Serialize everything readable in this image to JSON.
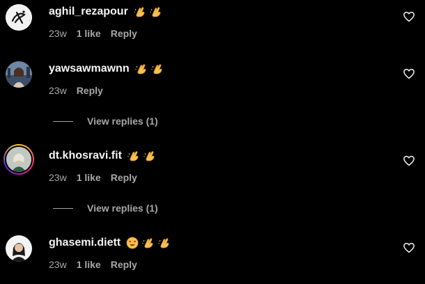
{
  "colors": {
    "background": "#000000",
    "username": "#f5f5f5",
    "meta": "#a8a8a8"
  },
  "comments": [
    {
      "username": "aghil_rezapour",
      "emojis": [
        "clapping-hands-emoji",
        "clapping-hands-emoji"
      ],
      "time": "23w",
      "likes": "1 like",
      "reply": "Reply",
      "avatar": "calligraphy-logo-avatar"
    },
    {
      "username": "yawsawmawnn",
      "emojis": [
        "clapping-hands-emoji",
        "clapping-hands-emoji"
      ],
      "time": "23w",
      "likes": "",
      "reply": "Reply",
      "view_replies": "View replies (1)",
      "avatar": "city-photo-avatar"
    },
    {
      "username": "dt.khosravi.fit",
      "emojis": [
        "clapping-hands-emoji",
        "clapping-hands-emoji"
      ],
      "time": "23w",
      "likes": "1 like",
      "reply": "Reply",
      "view_replies": "View replies (1)",
      "avatar": "story-ring-avatar"
    },
    {
      "username": "ghasemi.diett",
      "emojis": [
        "heart-eyes-emoji",
        "clapping-hands-emoji",
        "clapping-hands-emoji"
      ],
      "time": "23w",
      "likes": "1 like",
      "reply": "Reply",
      "avatar": "portrait-avatar"
    }
  ]
}
